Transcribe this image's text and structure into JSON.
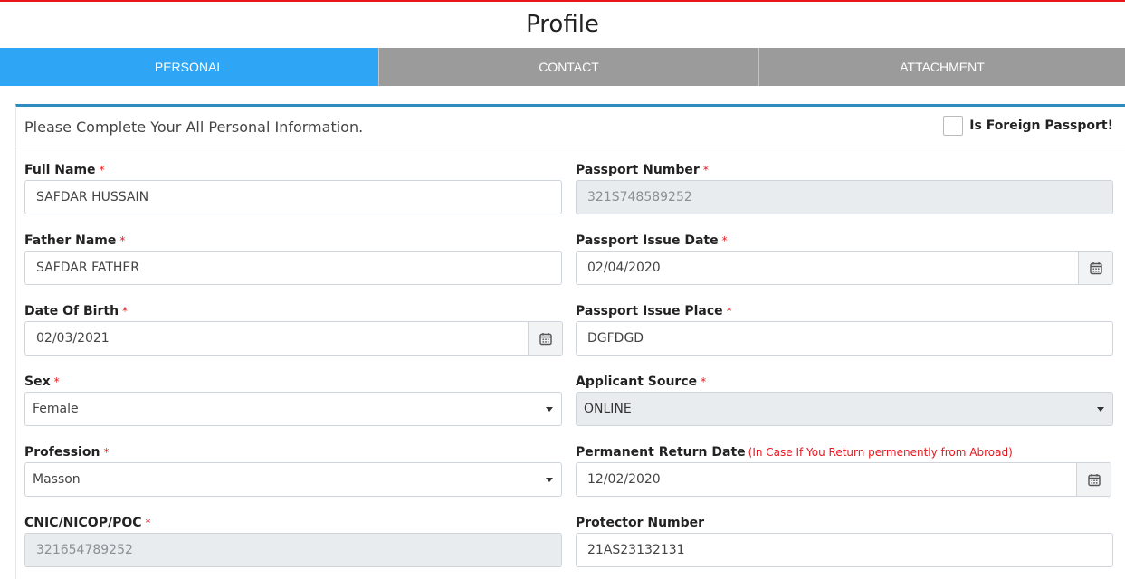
{
  "page": {
    "title": "Profile"
  },
  "tabs": [
    {
      "label": "PERSONAL",
      "active": true
    },
    {
      "label": "CONTACT",
      "active": false
    },
    {
      "label": "ATTACHMENT",
      "active": false
    }
  ],
  "panel": {
    "lead": "Please Complete Your All Personal Information.",
    "foreign_passport_label": "Is Foreign Passport!",
    "foreign_passport_checked": false
  },
  "required_mark": "*",
  "fields": {
    "full_name": {
      "label": "Full Name",
      "value": "SAFDAR HUSSAIN"
    },
    "father_name": {
      "label": "Father Name",
      "value": "SAFDAR FATHER"
    },
    "dob": {
      "label": "Date Of Birth",
      "value": "02/03/2021"
    },
    "sex": {
      "label": "Sex",
      "value": "Female"
    },
    "profession": {
      "label": "Profession",
      "value": "Masson"
    },
    "cnic": {
      "label": "CNIC/NICOP/POC",
      "value": "321654789252"
    },
    "passport_number": {
      "label": "Passport Number",
      "value": "321S748589252"
    },
    "passport_issue_date": {
      "label": "Passport Issue Date",
      "value": "02/04/2020"
    },
    "passport_issue_place": {
      "label": "Passport Issue Place",
      "value": "DGFDGD"
    },
    "applicant_source": {
      "label": "Applicant Source",
      "value": "ONLINE"
    },
    "permanent_return_date": {
      "label": "Permanent Return Date",
      "note": "(In Case If You Return permenently from Abroad)",
      "value": "12/02/2020"
    },
    "protector_number": {
      "label": "Protector Number",
      "value": "21AS23132131"
    }
  },
  "icons": {
    "calendar": "calendar-icon",
    "dropdown": "chevron-down-icon"
  },
  "colors": {
    "active_tab": "#2ea6f5",
    "inactive_tab": "#9b9b9b",
    "required": "#e8161b",
    "panel_accent": "#2e8bc0"
  }
}
